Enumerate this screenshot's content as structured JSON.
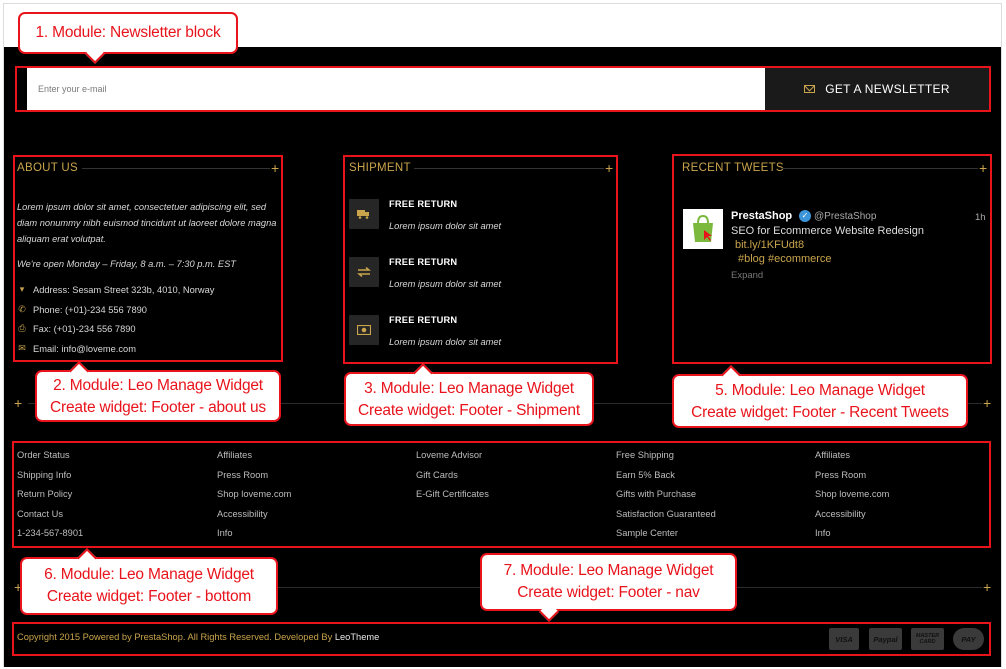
{
  "newsletter": {
    "placeholder": "Enter your e-mail",
    "button_label": "GET A NEWSLETTER"
  },
  "about": {
    "title": "ABOUT US",
    "text": "Lorem ipsum dolor sit amet, consectetuer adipiscing elit, sed diam nonummy nibh euismod tincidunt ut laoreet dolore magna aliquam erat volutpat.",
    "hours": "We're open Monday – Friday, 8 a.m. – 7:30 p.m. EST",
    "address": "Address: Sesam Street 323b, 4010, Norway",
    "phone": "Phone: (+01)-234 556 7890",
    "fax": "Fax: (+01)-234 556 7890",
    "email": "Email: info@loveme.com"
  },
  "shipment": {
    "title": "SHIPMENT",
    "items": [
      {
        "heading": "FREE RETURN",
        "desc": "Lorem ipsum dolor sit amet",
        "icon": "truck-icon"
      },
      {
        "heading": "FREE RETURN",
        "desc": "Lorem ipsum dolor sit amet",
        "icon": "exchange-icon"
      },
      {
        "heading": "FREE RETURN",
        "desc": "Lorem ipsum dolor sit amet",
        "icon": "money-icon"
      }
    ]
  },
  "tweets": {
    "title": "RECENT TWEETS",
    "name": "PrestaShop",
    "handle": "@PrestaShop",
    "time": "1h",
    "text": "SEO for Ecommerce Website Redesign",
    "link": "bit.ly/1KFUdt8",
    "tags": "#blog #ecommerce",
    "expand": "Expand"
  },
  "links": {
    "col1": [
      "Order Status",
      "Shipping Info",
      "Return Policy",
      "Contact Us",
      "1-234-567-8901"
    ],
    "col2": [
      "Affiliates",
      "Press Room",
      "Shop loveme.com",
      "Accessibility",
      "Info"
    ],
    "col3": [
      "Loveme Advisor",
      "Gift Cards",
      "E-Gift Certificates"
    ],
    "col4": [
      "Free Shipping",
      "Earn 5% Back",
      "Gifts with Purchase",
      "Satisfaction Guaranteed",
      "Sample Center"
    ],
    "col5": [
      "Affiliates",
      "Press Room",
      "Shop loveme.com",
      "Accessibility",
      "Info"
    ]
  },
  "footer": {
    "copyright": "Copyright 2015 Powered by PrestaShop. All Rights Reserved. Developed By ",
    "developer": "LeoTheme",
    "payments": [
      "VISA",
      "Paypal",
      "MASTER CARD",
      "PAY"
    ]
  },
  "callouts": {
    "c1": "1. Module: Newsletter block",
    "c2_l1": "2. Module: Leo Manage Widget",
    "c2_l2": "Create widget: Footer - about us",
    "c3_l1": "3. Module: Leo Manage Widget",
    "c3_l2": "Create widget: Footer - Shipment",
    "c5_l1": "5. Module: Leo Manage Widget",
    "c5_l2": "Create widget: Footer - Recent Tweets",
    "c6_l1": "6. Module: Leo Manage Widget",
    "c6_l2": "Create widget: Footer - bottom",
    "c7_l1": "7. Module: Leo Manage Widget",
    "c7_l2": "Create widget: Footer - nav"
  },
  "colors": {
    "accent": "#c9a44c",
    "annotation": "#e8131b",
    "background": "#000000"
  }
}
